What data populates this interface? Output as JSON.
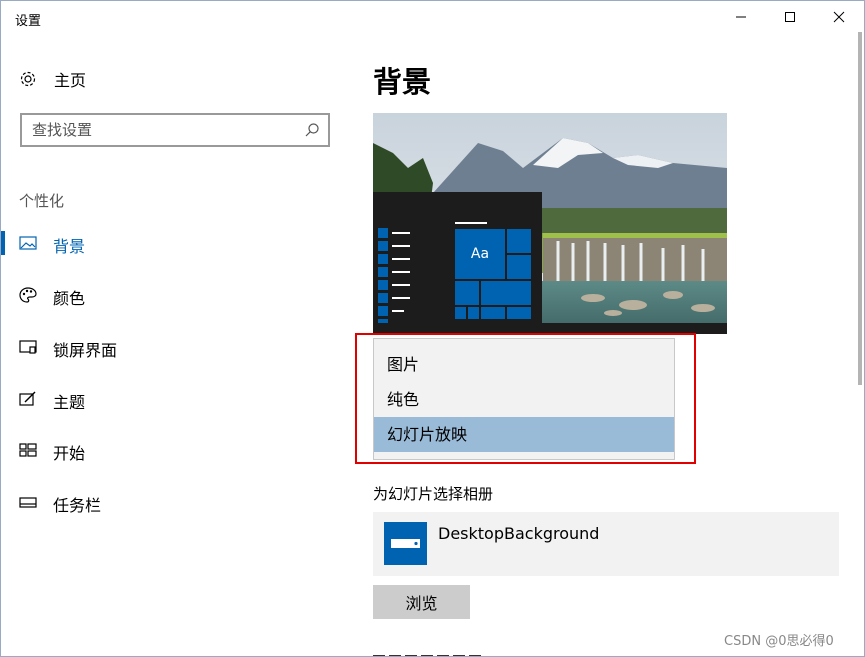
{
  "window": {
    "title": "设置"
  },
  "sidebar": {
    "home_label": "主页",
    "search_placeholder": "查找设置",
    "section_label": "个性化",
    "items": [
      {
        "label": "背景",
        "icon": "picture-icon",
        "active": true
      },
      {
        "label": "颜色",
        "icon": "palette-icon",
        "active": false
      },
      {
        "label": "锁屏界面",
        "icon": "lock-screen-icon",
        "active": false
      },
      {
        "label": "主题",
        "icon": "theme-icon",
        "active": false
      },
      {
        "label": "开始",
        "icon": "start-icon",
        "active": false
      },
      {
        "label": "任务栏",
        "icon": "taskbar-icon",
        "active": false
      }
    ]
  },
  "main": {
    "title": "背景",
    "preview_tile_text": "Aa",
    "background_options": [
      "图片",
      "纯色",
      "幻灯片放映"
    ],
    "selected_option": "幻灯片放映",
    "album_label": "为幻灯片选择相册",
    "album_name": "DesktopBackground",
    "browse_label": "浏览"
  },
  "colors": {
    "accent": "#0063b1",
    "selected_option_bg": "#99bbd8",
    "highlight_border": "#e00000"
  },
  "watermark": "CSDN @0思必得0"
}
